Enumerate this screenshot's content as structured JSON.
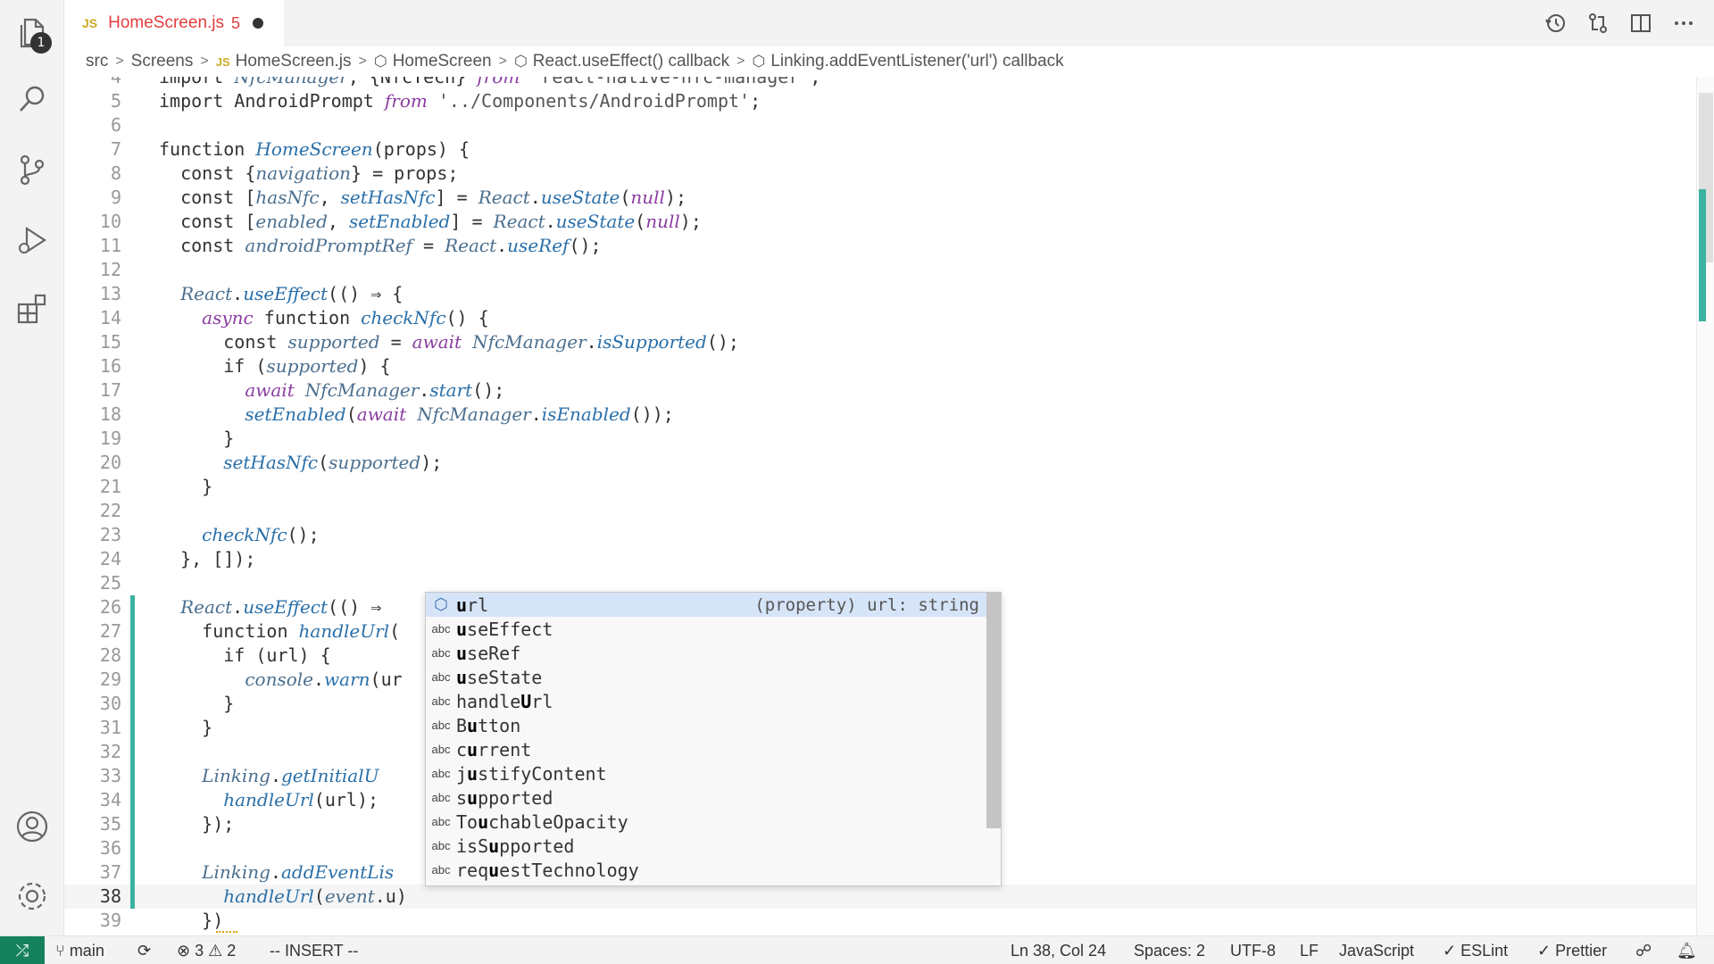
{
  "activity_bar": {
    "explorer_badge": "1",
    "icons": [
      "files-icon",
      "search-icon",
      "source-control-icon",
      "run-debug-icon",
      "extensions-icon",
      "account-icon",
      "settings-gear-icon"
    ]
  },
  "tab": {
    "lang_badge": "JS",
    "file_name": "HomeScreen.js",
    "problem_count": "5"
  },
  "breadcrumb": {
    "items": [
      "src",
      "Screens",
      "HomeScreen.js",
      "HomeScreen",
      "React.useEffect() callback",
      "Linking.addEventListener('url') callback"
    ],
    "js_badge": "JS"
  },
  "editor": {
    "lines": [
      {
        "n": "4",
        "text": "import NfcManager, {NfcTech} from 'react-native-nfc-manager';"
      },
      {
        "n": "5",
        "text": "import AndroidPrompt from '../Components/AndroidPrompt';"
      },
      {
        "n": "6",
        "text": ""
      },
      {
        "n": "7",
        "text": "function HomeScreen(props) {"
      },
      {
        "n": "8",
        "text": "  const {navigation} = props;"
      },
      {
        "n": "9",
        "text": "  const [hasNfc, setHasNfc] = React.useState(null);"
      },
      {
        "n": "10",
        "text": "  const [enabled, setEnabled] = React.useState(null);"
      },
      {
        "n": "11",
        "text": "  const androidPromptRef = React.useRef();"
      },
      {
        "n": "12",
        "text": ""
      },
      {
        "n": "13",
        "text": "  React.useEffect(() ⇒ {"
      },
      {
        "n": "14",
        "text": "    async function checkNfc() {"
      },
      {
        "n": "15",
        "text": "      const supported = await NfcManager.isSupported();"
      },
      {
        "n": "16",
        "text": "      if (supported) {"
      },
      {
        "n": "17",
        "text": "        await NfcManager.start();"
      },
      {
        "n": "18",
        "text": "        setEnabled(await NfcManager.isEnabled());"
      },
      {
        "n": "19",
        "text": "      }"
      },
      {
        "n": "20",
        "text": "      setHasNfc(supported);"
      },
      {
        "n": "21",
        "text": "    }"
      },
      {
        "n": "22",
        "text": ""
      },
      {
        "n": "23",
        "text": "    checkNfc();"
      },
      {
        "n": "24",
        "text": "  }, []);"
      },
      {
        "n": "25",
        "text": ""
      },
      {
        "n": "26",
        "text": "  React.useEffect(() ⇒"
      },
      {
        "n": "27",
        "text": "    function handleUrl("
      },
      {
        "n": "28",
        "text": "      if (url) {"
      },
      {
        "n": "29",
        "text": "        console.warn(ur"
      },
      {
        "n": "30",
        "text": "      }"
      },
      {
        "n": "31",
        "text": "    }"
      },
      {
        "n": "32",
        "text": ""
      },
      {
        "n": "33",
        "text": "    Linking.getInitialU"
      },
      {
        "n": "34",
        "text": "      handleUrl(url);"
      },
      {
        "n": "35",
        "text": "    });"
      },
      {
        "n": "36",
        "text": ""
      },
      {
        "n": "37",
        "text": "    Linking.addEventLis"
      },
      {
        "n": "38",
        "text": "      handleUrl(event.u)"
      },
      {
        "n": "39",
        "text": "    })"
      }
    ]
  },
  "suggest": {
    "items": [
      {
        "kind": "property",
        "label_match": "u",
        "label_rest": "rl",
        "detail": "(property) url: string"
      },
      {
        "kind": "abc",
        "label_match": "u",
        "label_rest": "seEffect"
      },
      {
        "kind": "abc",
        "label_match": "u",
        "label_rest": "seRef"
      },
      {
        "kind": "abc",
        "label_match": "u",
        "label_rest": "seState"
      },
      {
        "kind": "abc",
        "label_pre": "handle",
        "label_match": "U",
        "label_rest": "rl"
      },
      {
        "kind": "abc",
        "label_pre": "B",
        "label_match": "u",
        "label_rest": "tton"
      },
      {
        "kind": "abc",
        "label_pre": "c",
        "label_match": "u",
        "label_rest": "rrent"
      },
      {
        "kind": "abc",
        "label_pre": "j",
        "label_match": "u",
        "label_rest": "stifyContent"
      },
      {
        "kind": "abc",
        "label_pre": "s",
        "label_match": "u",
        "label_rest": "pported"
      },
      {
        "kind": "abc",
        "label_pre": "To",
        "label_match": "u",
        "label_rest": "chableOpacity"
      },
      {
        "kind": "abc",
        "label_pre": "isS",
        "label_match": "u",
        "label_rest": "pported"
      },
      {
        "kind": "abc",
        "label_pre": "req",
        "label_match": "u",
        "label_rest": "estTechnology"
      }
    ],
    "abc_label": "abc"
  },
  "status_bar": {
    "branch": "main",
    "errors": "3",
    "warnings": "2",
    "mode": "-- INSERT --",
    "cursor": "Ln 38, Col 24",
    "spaces": "Spaces: 2",
    "encoding": "UTF-8",
    "eol": "LF",
    "language": "JavaScript",
    "eslint": "ESLint",
    "prettier": "Prettier"
  }
}
